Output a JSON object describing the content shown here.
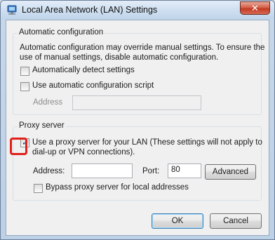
{
  "window": {
    "title": "Local Area Network (LAN) Settings",
    "close_glyph": "✕"
  },
  "auto_config": {
    "legend": "Automatic configuration",
    "description": "Automatic configuration may override manual settings. To ensure the use of manual settings, disable automatic configuration.",
    "auto_detect": {
      "label": "Automatically detect settings",
      "checked": false
    },
    "use_script": {
      "label": "Use automatic configuration script",
      "checked": false
    },
    "address_label": "Address",
    "address_value": ""
  },
  "proxy": {
    "legend": "Proxy server",
    "use_proxy": {
      "label_line1": "Use a proxy server for your LAN (These settings will not apply to",
      "label_line2": "dial-up or VPN connections).",
      "checked": true
    },
    "address_label": "Address:",
    "address_value": "",
    "port_label": "Port:",
    "port_value": "80",
    "advanced_label": "Advanced",
    "bypass": {
      "label": "Bypass proxy server for local addresses",
      "checked": false
    }
  },
  "buttons": {
    "ok_label": "OK",
    "cancel_label": "Cancel"
  },
  "colors": {
    "highlight": "#e0201b",
    "close_button": "#c23a24"
  }
}
